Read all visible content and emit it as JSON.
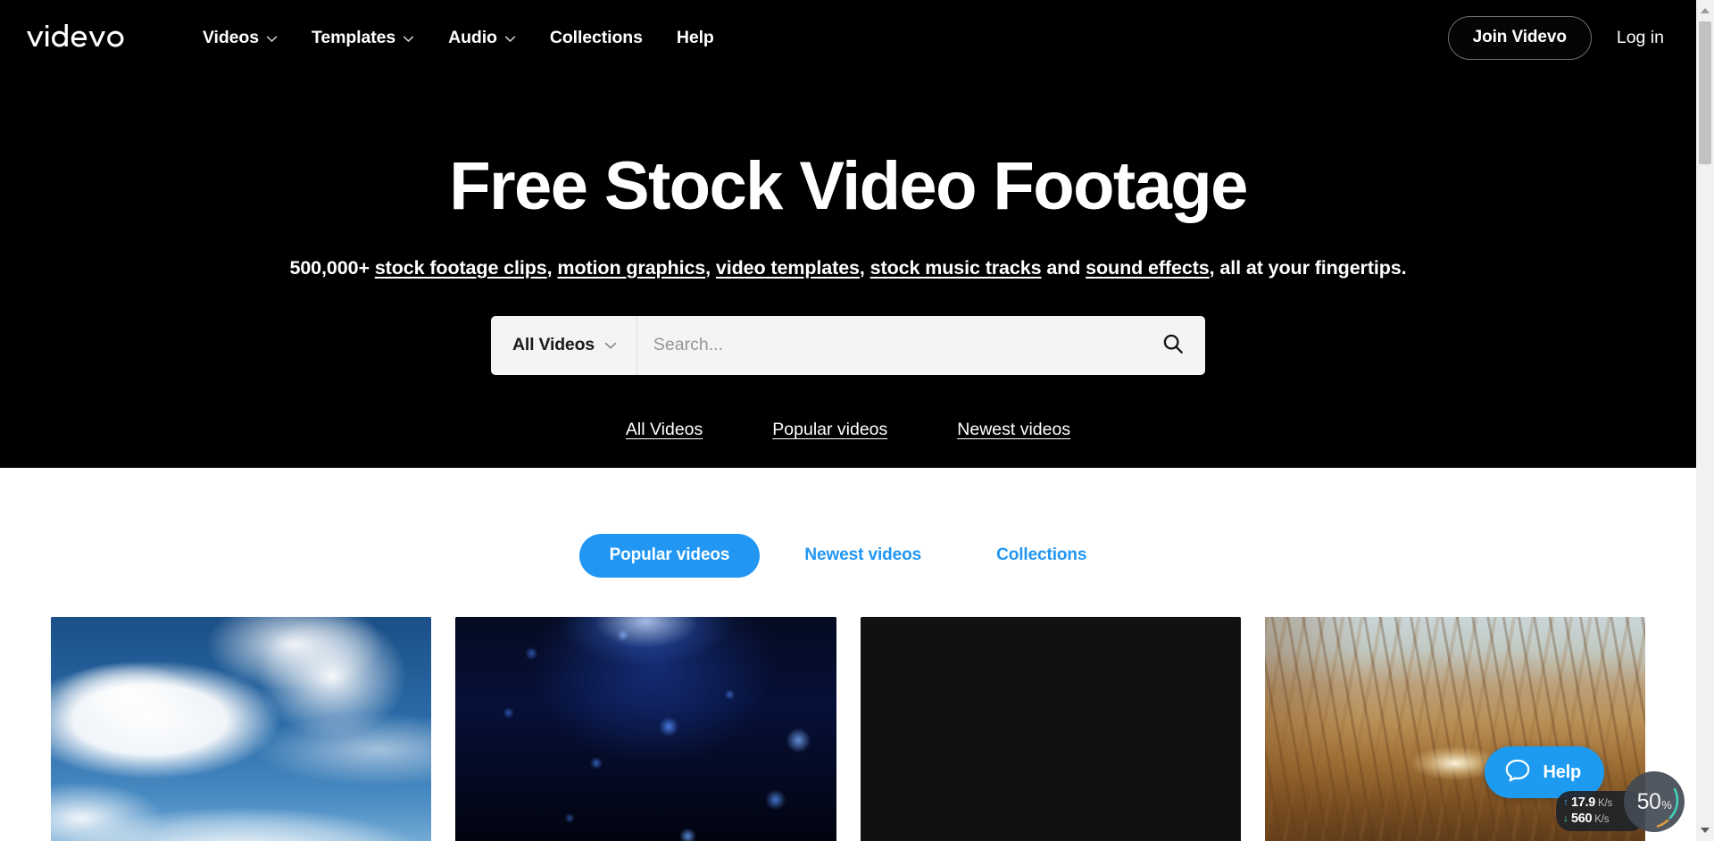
{
  "brand": {
    "name": "videvo"
  },
  "header": {
    "nav": [
      {
        "label": "Videos",
        "has_caret": true,
        "icon": "chevron-down-icon"
      },
      {
        "label": "Templates",
        "has_caret": true,
        "icon": "chevron-down-icon"
      },
      {
        "label": "Audio",
        "has_caret": true,
        "icon": "chevron-down-icon"
      },
      {
        "label": "Collections",
        "has_caret": false
      },
      {
        "label": "Help",
        "has_caret": false
      }
    ],
    "join_label": "Join Videvo",
    "login_label": "Log in"
  },
  "hero": {
    "title": "Free Stock Video Footage",
    "subtitle": {
      "prefix": "500,000+ ",
      "parts": [
        {
          "text": "stock footage clips",
          "link": true
        },
        {
          "text": ", ",
          "link": false
        },
        {
          "text": "motion graphics",
          "link": true
        },
        {
          "text": ", ",
          "link": false
        },
        {
          "text": "video templates",
          "link": true
        },
        {
          "text": ", ",
          "link": false
        },
        {
          "text": "stock music tracks",
          "link": true
        },
        {
          "text": " and ",
          "link": false
        },
        {
          "text": "sound effects",
          "link": true
        },
        {
          "text": ", all at your fingertips.",
          "link": false
        }
      ]
    },
    "search": {
      "category_label": "All Videos",
      "category_icon": "chevron-down-icon",
      "placeholder": "Search...",
      "value": "",
      "submit_icon": "search-icon"
    },
    "quick_links": [
      {
        "label": "All Videos"
      },
      {
        "label": "Popular videos"
      },
      {
        "label": "Newest videos"
      }
    ]
  },
  "content": {
    "tabs": [
      {
        "label": "Popular videos",
        "active": true
      },
      {
        "label": "Newest videos",
        "active": false
      },
      {
        "label": "Collections",
        "active": false
      }
    ],
    "cards": [
      {
        "name": "blue-sky-clouds-clip",
        "style": "thumb-sky"
      },
      {
        "name": "blue-particles-clip",
        "style": "thumb-particles"
      },
      {
        "name": "cloudy-sunset-sea-clip",
        "style": "thumb-sunset-fix"
      },
      {
        "name": "golden-wheat-field-clip",
        "style": "thumb-wheat"
      }
    ]
  },
  "widgets": {
    "help": {
      "label": "Help",
      "icon": "chat-bubble-icon"
    },
    "network": {
      "upload": {
        "value": "17.9",
        "unit": "K/s",
        "arrow": "↑"
      },
      "download": {
        "value": "560",
        "unit": "K/s",
        "arrow": "↓"
      }
    },
    "zoom": {
      "value": "50",
      "unit": "%"
    }
  },
  "colors": {
    "accent_blue": "#2196f3",
    "help_blue": "#1d9bf0",
    "header_bg": "#000000",
    "page_bg": "#ffffff"
  }
}
